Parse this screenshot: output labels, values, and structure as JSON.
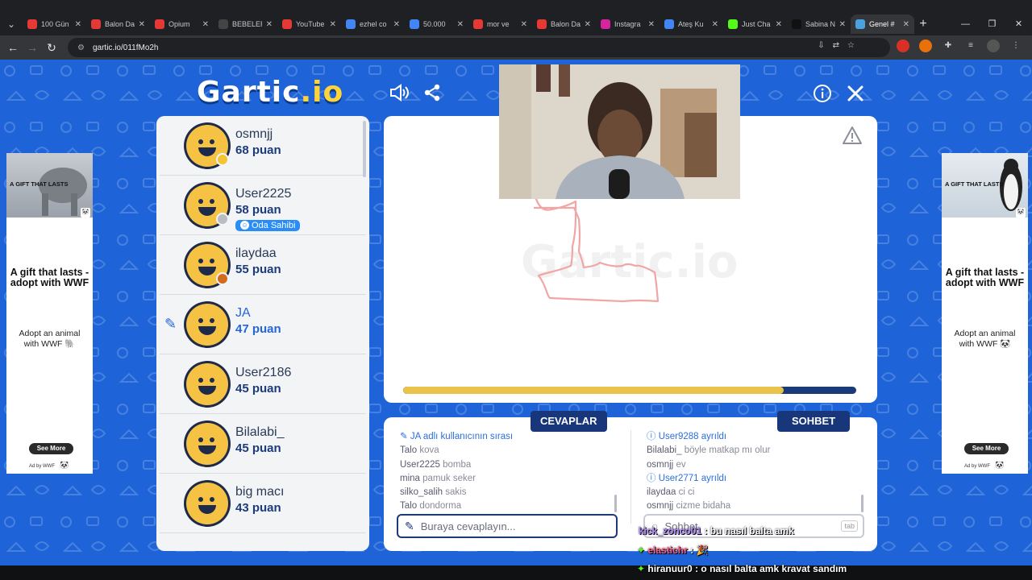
{
  "browser": {
    "tabs": [
      {
        "title": "100 Gün",
        "color": "#e53935"
      },
      {
        "title": "Balon Da",
        "color": "#e53935"
      },
      {
        "title": "Opium",
        "color": "#e53935"
      },
      {
        "title": "BEBELER",
        "color": "#444444"
      },
      {
        "title": "YouTube",
        "color": "#e53935"
      },
      {
        "title": "ezhel co",
        "color": "#4285f4"
      },
      {
        "title": "50.000",
        "color": "#4285f4"
      },
      {
        "title": "mor ve",
        "color": "#e53935"
      },
      {
        "title": "Balon Da",
        "color": "#e53935"
      },
      {
        "title": "Instagra",
        "color": "#d6249f"
      },
      {
        "title": "Ateş Ku",
        "color": "#4285f4"
      },
      {
        "title": "Just Cha",
        "color": "#53fc18"
      },
      {
        "title": "Sabina N",
        "color": "#111111"
      },
      {
        "title": "Genel #",
        "color": "#4aa3df",
        "active": true
      }
    ],
    "url": "gartic.io/011fMo2h"
  },
  "logo": {
    "text": "Gartic",
    "suffix": ".io"
  },
  "players": [
    {
      "name": "osmnjj",
      "points": "68 puan",
      "dot": "#f5c431"
    },
    {
      "name": "User2225",
      "points": "58 puan",
      "dot": "#b9bcc2",
      "badge": "Oda Sahibi"
    },
    {
      "name": "ilaydaa",
      "points": "55 puan",
      "dot": "#d36a1c"
    },
    {
      "name": "JA",
      "points": "47 puan",
      "drawing": true
    },
    {
      "name": "User2186",
      "points": "45 puan"
    },
    {
      "name": "Bilalabi_",
      "points": "45 puan"
    },
    {
      "name": "big macı",
      "points": "43 puan"
    }
  ],
  "round": {
    "timer_progress": 0.84
  },
  "answers": {
    "label": "CEVAPLAR",
    "system": "JA adlı kullanıcının sırası",
    "messages": [
      {
        "user": "Talo",
        "text": "kova"
      },
      {
        "user": "User2225",
        "text": "bomba"
      },
      {
        "user": "mina",
        "text": "pamuk seker"
      },
      {
        "user": "silko_salih",
        "text": "sakis"
      },
      {
        "user": "Talo",
        "text": "dondorma"
      }
    ],
    "placeholder": "Buraya cevaplayın..."
  },
  "chat": {
    "label": "SOHBET",
    "rows": [
      {
        "type": "system",
        "user": "User9288",
        "text": "ayrıldı"
      },
      {
        "type": "msg",
        "user": "Bilalabi_",
        "text": "böyle matkap mı olur"
      },
      {
        "type": "msg",
        "user": "osmnjj",
        "text": "ev"
      },
      {
        "type": "system",
        "user": "User2771",
        "text": "ayrıldı"
      },
      {
        "type": "msg",
        "user": "ilaydaa",
        "text": "ci ci"
      },
      {
        "type": "msg",
        "user": "osmnjj",
        "text": "cizme bidaha"
      }
    ],
    "placeholder": "Sohbet",
    "tab_hint": "tab"
  },
  "ads": {
    "image_caption": "A GIFT THAT LASTS",
    "headline": "A gift that lasts - adopt with WWF",
    "sub_left": "Adopt an animal with WWF 🐘",
    "sub_right": "Adopt an animal with WWF 🐼",
    "cta": "See More",
    "ad_by": "Ad by WWF"
  },
  "stream_overlay": [
    {
      "user": "kick_zonco01",
      "text": ": bu nasıl balta amk",
      "color": "#b58cff"
    },
    {
      "user": "elastichr",
      "text": ":",
      "color": "#ff5c8a",
      "emoji": "🎉"
    },
    {
      "user": "hiranuur0",
      "text": ": o nasıl balta amk kravat sandım",
      "color": "#ffffff"
    }
  ]
}
